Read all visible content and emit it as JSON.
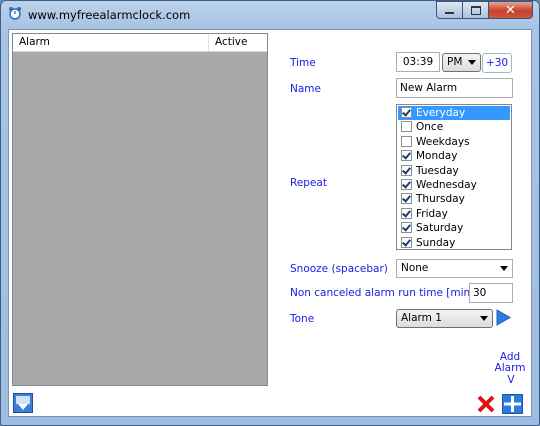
{
  "window": {
    "title": "www.myfreealarmclock.com"
  },
  "alarm_list": {
    "columns": [
      "Alarm",
      "Active"
    ]
  },
  "form": {
    "time_label": "Time",
    "time_value": "03:39",
    "ampm_value": "PM",
    "plus30_label": "+30",
    "name_label": "Name",
    "name_value": "New Alarm",
    "repeat_label": "Repeat",
    "repeat_options": [
      {
        "label": "Everyday",
        "checked": true,
        "selected": true
      },
      {
        "label": "Once",
        "checked": false
      },
      {
        "label": "Weekdays",
        "checked": false
      },
      {
        "label": "Monday",
        "checked": true
      },
      {
        "label": "Tuesday",
        "checked": true
      },
      {
        "label": "Wednesday",
        "checked": true
      },
      {
        "label": "Thursday",
        "checked": true
      },
      {
        "label": "Friday",
        "checked": true
      },
      {
        "label": "Saturday",
        "checked": true
      },
      {
        "label": "Sunday",
        "checked": true
      }
    ],
    "snooze_label": "Snooze (spacebar)",
    "snooze_value": "None",
    "runtime_label": "Non canceled alarm run time [min]",
    "runtime_value": "30",
    "tone_label": "Tone",
    "tone_value": "Alarm 1"
  },
  "actions": {
    "add_alarm_label": "Add Alarm",
    "add_hint": "V"
  },
  "icons": {
    "app": "alarm-clock-icon",
    "play": "play-icon",
    "delete": "delete-x-icon",
    "add": "add-plus-icon",
    "save": "save-arrow-icon"
  }
}
